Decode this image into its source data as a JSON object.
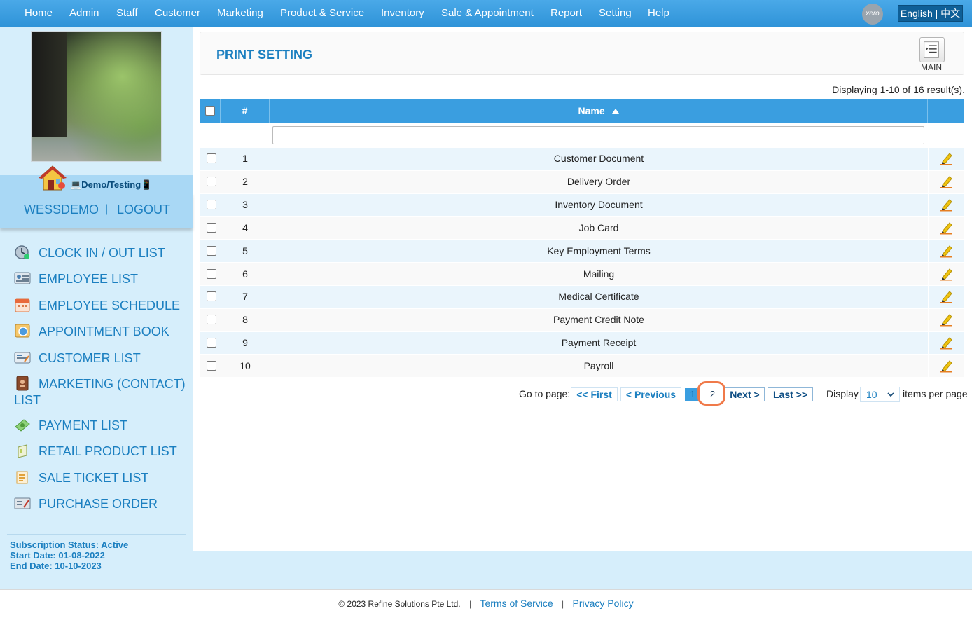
{
  "nav": {
    "items": [
      {
        "label": "Home"
      },
      {
        "label": "Admin"
      },
      {
        "label": "Staff"
      },
      {
        "label": "Customer"
      },
      {
        "label": "Marketing"
      },
      {
        "label": "Product & Service"
      },
      {
        "label": "Inventory"
      },
      {
        "label": "Sale & Appointment"
      },
      {
        "label": "Report"
      },
      {
        "label": "Setting"
      },
      {
        "label": "Help"
      }
    ],
    "xero_label": "xero",
    "lang_en": "English",
    "lang_sep": " | ",
    "lang_cn": "中文"
  },
  "sidebar": {
    "company": "💻Demo/Testing📱",
    "user": "WESSDEMO",
    "user_sep": "|",
    "logout": "LOGOUT",
    "menu": [
      {
        "label": "CLOCK IN / OUT LIST",
        "icon": "clock-icon"
      },
      {
        "label": "EMPLOYEE LIST",
        "icon": "id-card-icon"
      },
      {
        "label": "EMPLOYEE SCHEDULE",
        "icon": "calendar-icon"
      },
      {
        "label": "APPOINTMENT BOOK",
        "icon": "book-icon"
      },
      {
        "label": "CUSTOMER LIST",
        "icon": "customer-card-icon"
      },
      {
        "label": "MARKETING (CONTACT) LIST",
        "icon": "contact-book-icon"
      },
      {
        "label": "PAYMENT LIST",
        "icon": "money-icon"
      },
      {
        "label": "RETAIL PRODUCT LIST",
        "icon": "product-box-icon"
      },
      {
        "label": "SALE TICKET LIST",
        "icon": "ticket-icon"
      },
      {
        "label": "PURCHASE ORDER",
        "icon": "purchase-order-icon"
      }
    ],
    "subscription": {
      "status": "Subscription Status: Active",
      "start": "Start Date: 01-08-2022",
      "end": "End Date: 10-10-2023"
    }
  },
  "header": {
    "title": "PRINT SETTING",
    "main_label": "MAIN"
  },
  "table": {
    "result_text": "Displaying 1-10 of 16 result(s).",
    "col_num": "#",
    "col_name": "Name",
    "rows": [
      {
        "num": "1",
        "name": "Customer Document"
      },
      {
        "num": "2",
        "name": "Delivery Order"
      },
      {
        "num": "3",
        "name": "Inventory Document"
      },
      {
        "num": "4",
        "name": "Job Card"
      },
      {
        "num": "5",
        "name": "Key Employment Terms"
      },
      {
        "num": "6",
        "name": "Mailing"
      },
      {
        "num": "7",
        "name": "Medical Certificate"
      },
      {
        "num": "8",
        "name": "Payment Credit Note"
      },
      {
        "num": "9",
        "name": "Payment Receipt"
      },
      {
        "num": "10",
        "name": "Payroll"
      }
    ]
  },
  "pager": {
    "goto_label": "Go to page:",
    "first": "<< First",
    "previous": "< Previous",
    "current": "1",
    "page2": "2",
    "next": "Next >",
    "last": "Last >>",
    "display_label": "Display",
    "per_page": "10",
    "items_label": "items per page"
  },
  "footer": {
    "copyright": "© 2023 Refine Solutions Pte Ltd.",
    "sep": "|",
    "terms": "Terms of Service",
    "privacy": "Privacy Policy"
  },
  "colors": {
    "nav_bg": "#3a9ee0",
    "sidebar_bg": "#d6eefb",
    "link": "#1b7fc0",
    "highlight_ring": "#f07a4a"
  }
}
